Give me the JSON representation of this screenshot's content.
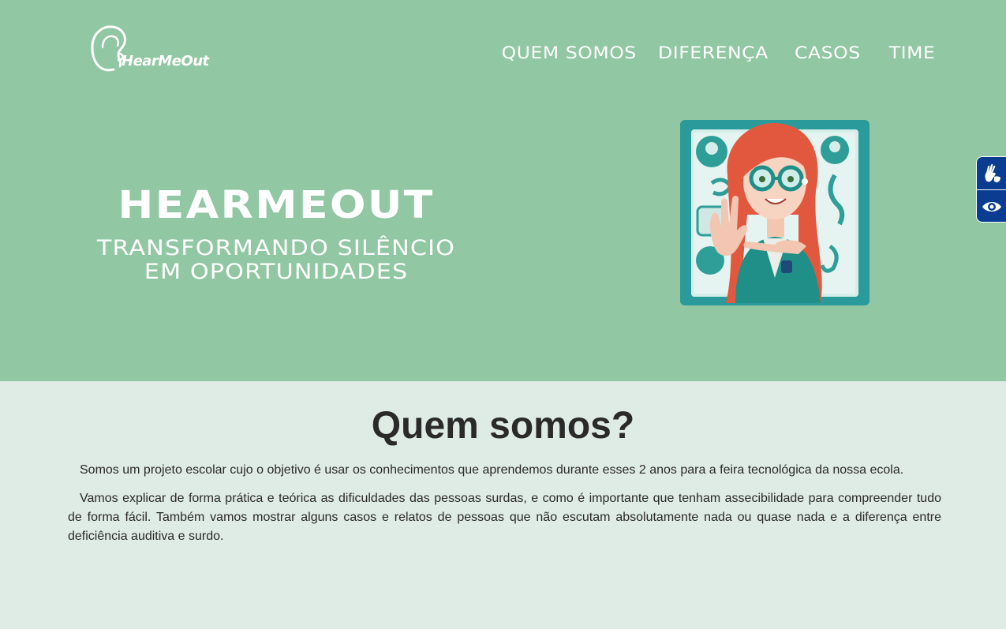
{
  "header": {
    "logo_text": "HearMeOut",
    "nav": [
      {
        "label": "QUEM SOMOS"
      },
      {
        "label": "DIFERENÇA"
      },
      {
        "label": "CASOS"
      },
      {
        "label": "TIME"
      }
    ]
  },
  "hero": {
    "title": "HEARMEOUT",
    "subtitle_line1": "TRANSFORMANDO SILÊNCIO",
    "subtitle_line2": "EM OPORTUNIDADES",
    "background_color": "#91c7a3"
  },
  "accessibility": {
    "buttons": [
      {
        "icon": "sign-language-icon"
      },
      {
        "icon": "eye-icon"
      }
    ],
    "color": "#0a3d91"
  },
  "about": {
    "title": "Quem somos?",
    "paragraph1": "Somos um projeto escolar cujo o objetivo é usar os conhecimentos que aprendemos durante esses 2 anos para a feira tecnológica da nossa ecola.",
    "paragraph2": "Vamos explicar de forma prática e teórica as dificuldades das pessoas surdas, e como é importante que tenham assecibilidade para compreender tudo de forma fácil. Também vamos mostrar alguns casos e relatos de pessoas que não escutam absolutamente nada ou quase nada e a diferença entre deficiência auditiva e surdo."
  }
}
